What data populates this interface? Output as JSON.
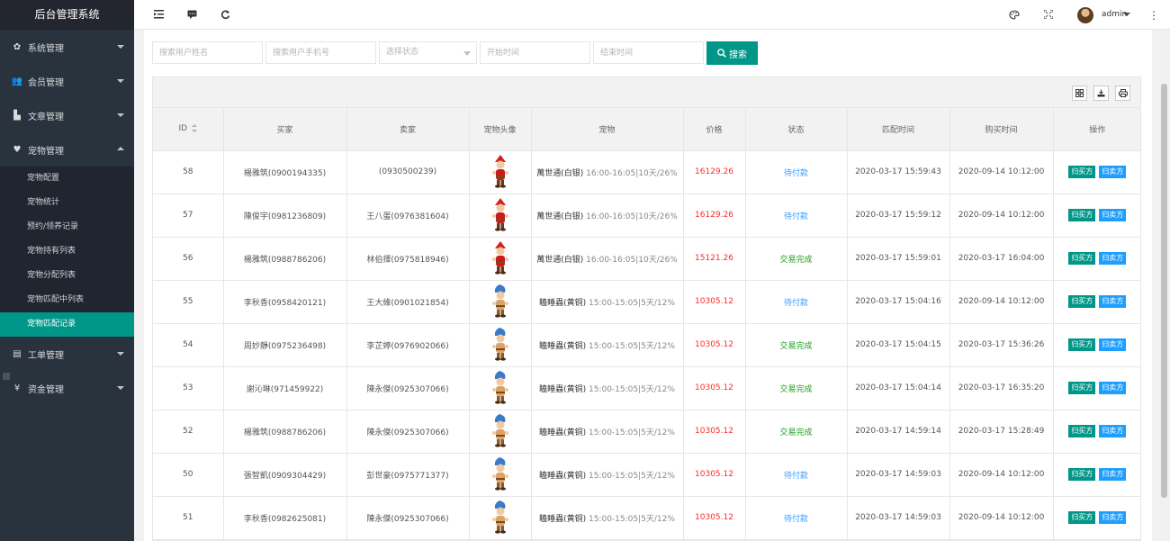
{
  "app_title": "后台管理系统",
  "sidebar": {
    "menus": [
      {
        "label": "系统管理",
        "icon": "gear-icon"
      },
      {
        "label": "会员管理",
        "icon": "users-icon"
      },
      {
        "label": "文章管理",
        "icon": "article-icon"
      },
      {
        "label": "宠物管理",
        "icon": "heart-icon"
      },
      {
        "label": "工单管理",
        "icon": "document-icon"
      },
      {
        "label": "资金管理",
        "icon": "yen-icon"
      }
    ],
    "pet_submenu": [
      "宠物配置",
      "宠物统计",
      "预约/领养记录",
      "宠物持有列表",
      "宠物分配列表",
      "宠物匹配中列表",
      "宠物匹配记录"
    ]
  },
  "header": {
    "user": "admin",
    "icons": [
      "menu-fold-icon",
      "message-icon",
      "refresh-icon",
      "theme-icon",
      "fullscreen-icon",
      "more-icon"
    ]
  },
  "search": {
    "username_placeholder": "搜索用户姓名",
    "phone_placeholder": "搜索用户手机号",
    "status_placeholder": "选择状态",
    "start_placeholder": "开始时间",
    "end_placeholder": "结束时间",
    "button_label": "搜索"
  },
  "table": {
    "columns": [
      "ID",
      "买家",
      "卖家",
      "宠物头像",
      "宠物",
      "价格",
      "状态",
      "匹配时间",
      "购买时间",
      "操作"
    ],
    "action_buyer": "归买方",
    "action_seller": "归卖方",
    "rows": [
      {
        "id": "58",
        "buyer": "楊雅筑(0900194335)",
        "seller": "(0930500239)",
        "pet_img": "red-dwarf",
        "pet_name": "萬世通(白银)",
        "pet_time": "16:00-16:05|10天/26%",
        "price": "16129.26",
        "status": "待付款",
        "status_type": "wait",
        "match_time": "2020-03-17 15:59:43",
        "buy_time": "2020-09-14 10:12:00"
      },
      {
        "id": "57",
        "buyer": "陳俊宇(0981236809)",
        "seller": "王八蛋(0976381604)",
        "pet_img": "red-dwarf",
        "pet_name": "萬世通(白银)",
        "pet_time": "16:00-16:05|10天/26%",
        "price": "16129.26",
        "status": "待付款",
        "status_type": "wait",
        "match_time": "2020-03-17 15:59:12",
        "buy_time": "2020-09-14 10:12:00"
      },
      {
        "id": "56",
        "buyer": "楊雅筑(0988786206)",
        "seller": "林伯擇(0975818946)",
        "pet_img": "red-dwarf",
        "pet_name": "萬世通(白银)",
        "pet_time": "16:00-16:05|10天/26%",
        "price": "15121.26",
        "status": "交易完成",
        "status_type": "done",
        "match_time": "2020-03-17 15:59:01",
        "buy_time": "2020-03-17 16:04:00"
      },
      {
        "id": "55",
        "buyer": "李秋香(0958420121)",
        "seller": "王大維(0901021854)",
        "pet_img": "blue-dwarf",
        "pet_name": "瞌睡蟲(黄铜)",
        "pet_time": "15:00-15:05|5天/12%",
        "price": "10305.12",
        "status": "待付款",
        "status_type": "wait",
        "match_time": "2020-03-17 15:04:16",
        "buy_time": "2020-09-14 10:12:00"
      },
      {
        "id": "54",
        "buyer": "周妙靜(0975236498)",
        "seller": "李芷婷(0976902066)",
        "pet_img": "blue-dwarf",
        "pet_name": "瞌睡蟲(黄铜)",
        "pet_time": "15:00-15:05|5天/12%",
        "price": "10305.12",
        "status": "交易完成",
        "status_type": "done",
        "match_time": "2020-03-17 15:04:15",
        "buy_time": "2020-03-17 15:36:26"
      },
      {
        "id": "53",
        "buyer": "謝沁琳(971459922)",
        "seller": "陳永傑(0925307066)",
        "pet_img": "blue-dwarf",
        "pet_name": "瞌睡蟲(黄铜)",
        "pet_time": "15:00-15:05|5天/12%",
        "price": "10305.12",
        "status": "交易完成",
        "status_type": "done",
        "match_time": "2020-03-17 15:04:14",
        "buy_time": "2020-03-17 16:35:20"
      },
      {
        "id": "52",
        "buyer": "楊雅筑(0988786206)",
        "seller": "陳永傑(0925307066)",
        "pet_img": "blue-dwarf",
        "pet_name": "瞌睡蟲(黄铜)",
        "pet_time": "15:00-15:05|5天/12%",
        "price": "10305.12",
        "status": "交易完成",
        "status_type": "done",
        "match_time": "2020-03-17 14:59:14",
        "buy_time": "2020-03-17 15:28:49"
      },
      {
        "id": "50",
        "buyer": "張智凱(0909304429)",
        "seller": "彭世豪(0975771377)",
        "pet_img": "blue-dwarf",
        "pet_name": "瞌睡蟲(黄铜)",
        "pet_time": "15:00-15:05|5天/12%",
        "price": "10305.12",
        "status": "待付款",
        "status_type": "wait",
        "match_time": "2020-03-17 14:59:03",
        "buy_time": "2020-09-14 10:12:00"
      },
      {
        "id": "51",
        "buyer": "李秋香(0982625081)",
        "seller": "陳永傑(0925307066)",
        "pet_img": "blue-dwarf",
        "pet_name": "瞌睡蟲(黄铜)",
        "pet_time": "15:00-15:05|5天/12%",
        "price": "10305.12",
        "status": "待付款",
        "status_type": "wait",
        "match_time": "2020-03-17 14:59:03",
        "buy_time": "2020-09-14 10:12:00"
      }
    ]
  }
}
